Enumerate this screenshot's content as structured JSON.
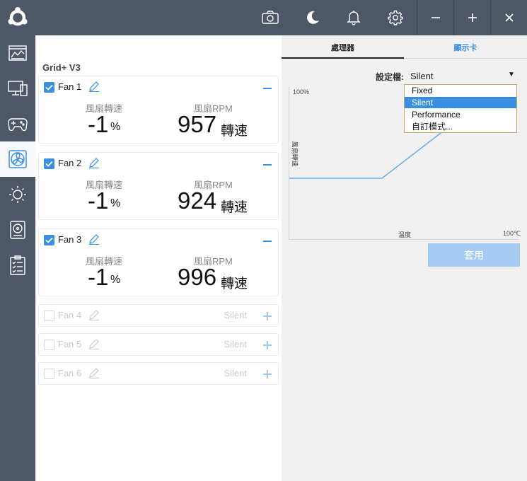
{
  "device": {
    "title": "Grid+ V3"
  },
  "fans": [
    {
      "name": "Fan 1",
      "checked": true,
      "speed_label": "風扇轉速",
      "speed_value": "-1",
      "speed_unit": "%",
      "rpm_label": "風扇RPM",
      "rpm_value": "957",
      "rpm_unit": "轉速"
    },
    {
      "name": "Fan 2",
      "checked": true,
      "speed_label": "風扇轉速",
      "speed_value": "-1",
      "speed_unit": "%",
      "rpm_label": "風扇RPM",
      "rpm_value": "924",
      "rpm_unit": "轉速"
    },
    {
      "name": "Fan 3",
      "checked": true,
      "speed_label": "風扇轉速",
      "speed_value": "-1",
      "speed_unit": "%",
      "rpm_label": "風扇RPM",
      "rpm_value": "996",
      "rpm_unit": "轉速"
    },
    {
      "name": "Fan 4",
      "checked": false,
      "mode": "Silent"
    },
    {
      "name": "Fan 5",
      "checked": false,
      "mode": "Silent"
    },
    {
      "name": "Fan 6",
      "checked": false,
      "mode": "Silent"
    }
  ],
  "tabs": [
    {
      "label": "處理器",
      "active": true
    },
    {
      "label": "顯示卡",
      "active": false
    }
  ],
  "profile": {
    "label": "設定檔:",
    "value": "Silent",
    "options": [
      "Fixed",
      "Silent",
      "Performance",
      "自訂模式..."
    ],
    "selected_index": 1
  },
  "chart": {
    "y_max_label": "100%",
    "y_label": "風扇轉速",
    "x_label": "溫度",
    "x_max_label": "100℃"
  },
  "apply_label": "套用",
  "colors": {
    "accent": "#3b8fe0",
    "chrome": "#4d5766",
    "apply_disabled": "#a6cdf1",
    "curve": "#6aaee8"
  },
  "toolbar_icons": [
    "camera-icon",
    "moon-icon",
    "bell-icon",
    "gear-icon"
  ],
  "sidebar_icons": [
    "dashboard-icon",
    "monitor-icon",
    "gamepad-icon",
    "fan-icon",
    "brightness-icon",
    "storage-icon",
    "checklist-icon"
  ]
}
